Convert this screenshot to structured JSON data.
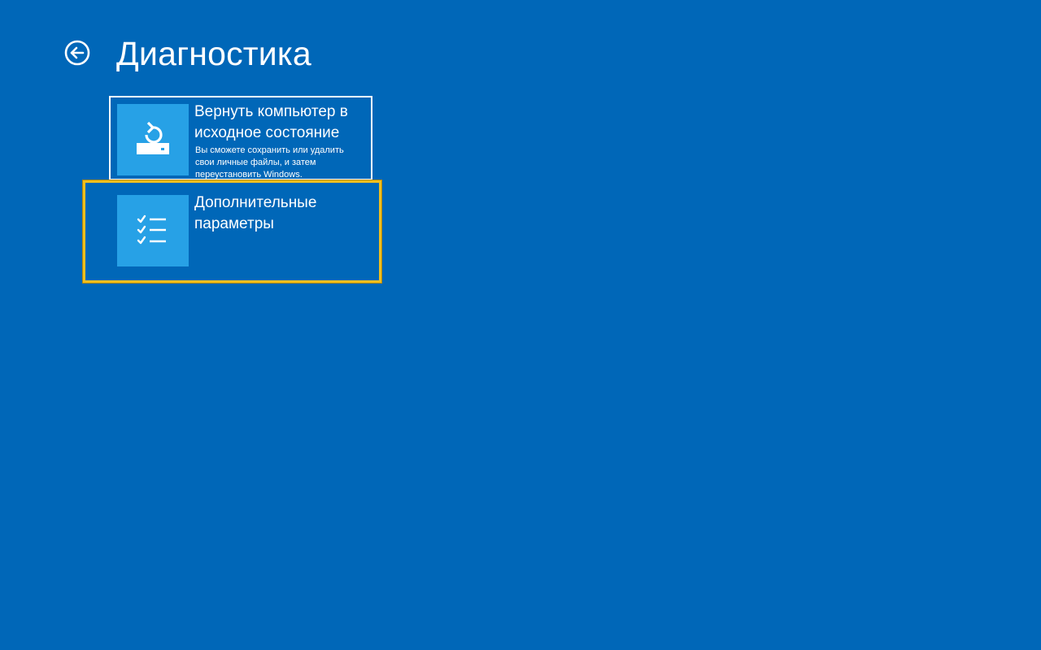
{
  "header": {
    "back_icon": "back-arrow-circle-icon",
    "title": "Диагностика"
  },
  "tiles": [
    {
      "icon": "reset-pc-icon",
      "title": "Вернуть компьютер в исходное состояние",
      "description": "Вы сможете сохранить или удалить свои личные файлы, и затем переустановить Windows.",
      "selected": false
    },
    {
      "icon": "checklist-icon",
      "title": "Дополнительные параметры",
      "selected": true
    }
  ],
  "colors": {
    "background": "#0067b8",
    "tile_icon_background": "#27a1e6",
    "selection_highlight": "#f0bf1e",
    "text": "#ffffff"
  }
}
